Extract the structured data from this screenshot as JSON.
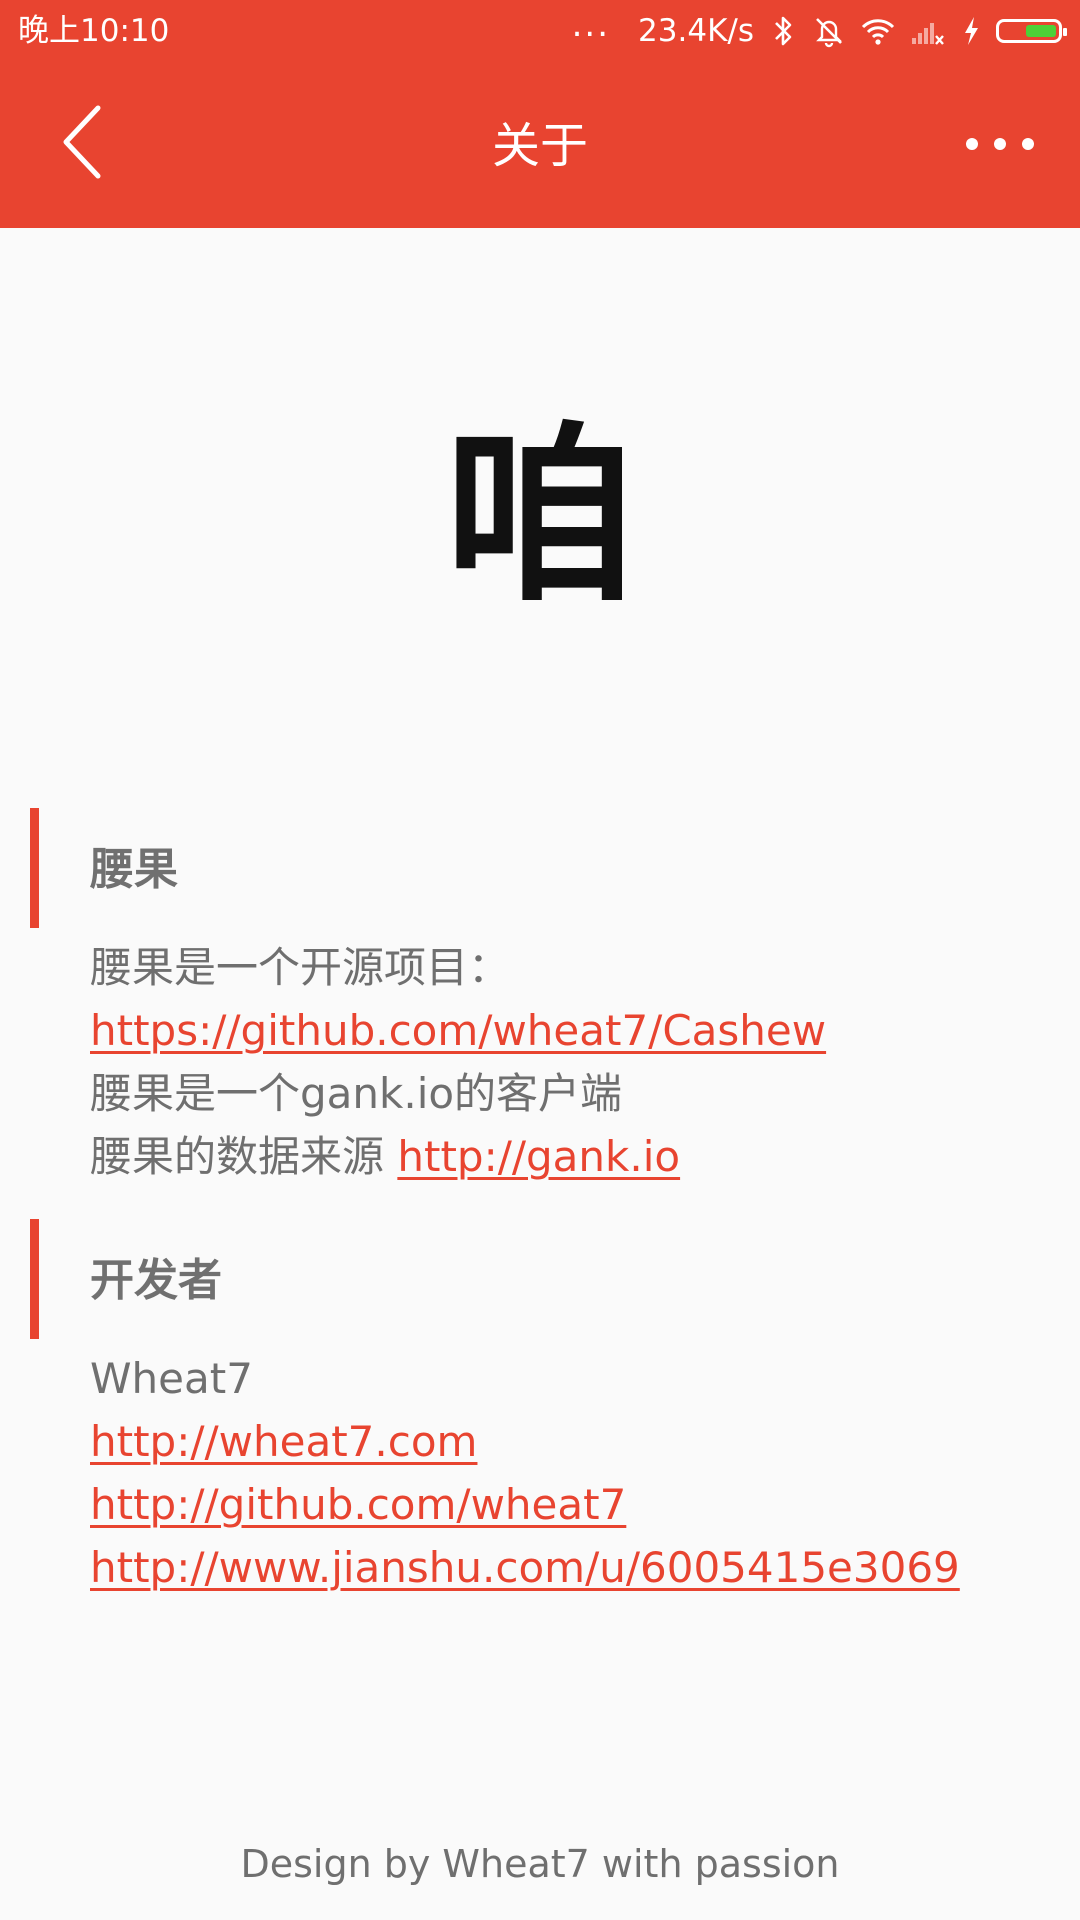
{
  "status_bar": {
    "time": "晚上10:10",
    "more": "...",
    "network_speed": "23.4K/s",
    "icons": [
      "bluetooth-icon",
      "mute-icon",
      "wifi-icon",
      "no-signal-icon",
      "charging-icon",
      "battery-icon"
    ],
    "battery_color": "#4cd137"
  },
  "app_bar": {
    "title": "关于",
    "back_icon": "chevron-left-icon",
    "more_icon": "more-horizontal-icon",
    "color": "#e84430"
  },
  "logo": {
    "char": "咱"
  },
  "about": {
    "title": "腰果",
    "intro": "腰果是一个开源项目：",
    "repo_link": "https://github.com/wheat7/Cashew",
    "client_desc": "腰果是一个gank.io的客户端",
    "source_prefix": "腰果的数据来源 ",
    "source_link": "http://gank.io"
  },
  "developer": {
    "title": "开发者",
    "name": "Wheat7",
    "links": [
      "http://wheat7.com",
      "http://github.com/wheat7",
      "http://www.jianshu.com/u/6005415e3069"
    ]
  },
  "footer": {
    "text": "Design by Wheat7 with passion"
  }
}
